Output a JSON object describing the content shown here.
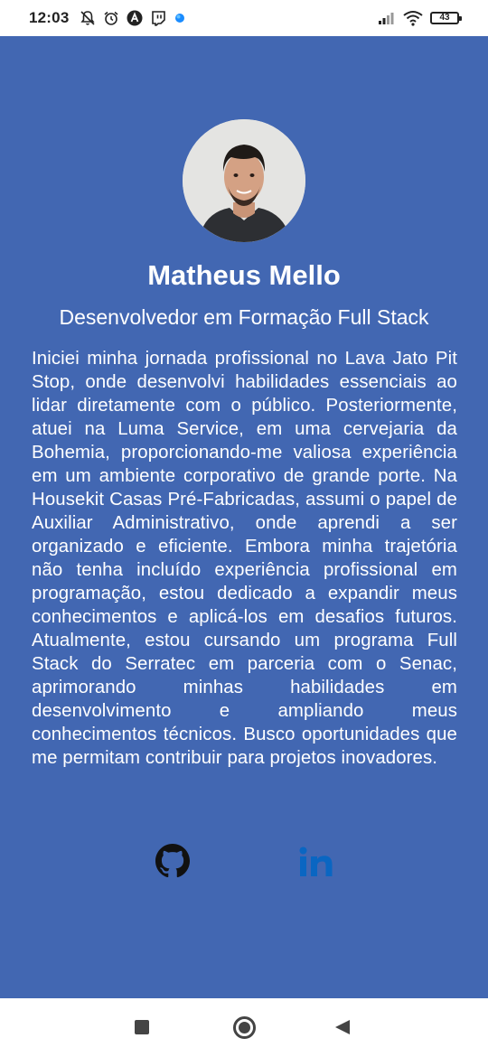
{
  "status_bar": {
    "time": "12:03",
    "icons_left": [
      "notifications-off-icon",
      "alarm-icon",
      "app-a-icon",
      "twitch-icon",
      "blue-dot-icon"
    ],
    "icons_right": [
      "signal-icon",
      "wifi-icon",
      "battery-icon"
    ],
    "battery_level": "43"
  },
  "profile": {
    "name": "Matheus Mello",
    "role": "Desenvolvedor em Formação Full Stack",
    "bio": "Iniciei minha jornada profissional no Lava Jato Pit Stop, onde desenvolvi habilidades essenciais ao lidar diretamente com o público. Posteriormente, atuei na Luma Service, em uma cervejaria da Bohemia, proporcionando-me valiosa experiência em um ambiente corporativo de grande porte. Na Housekit Casas Pré-Fabricadas, assumi o papel de Auxiliar Administrativo, onde aprendi a ser organizado e eficiente. Embora minha trajetória não tenha incluído experiência profissional em programação, estou dedicado a expandir meus conhecimentos e aplicá-los em desafios futuros. Atualmente, estou cursando um programa Full Stack do Serratec em parceria com o Senac, aprimorando minhas habilidades em desenvolvimento e ampliando meus conhecimentos técnicos. Busco oportunidades que me permitam contribuir para projetos inovadores."
  },
  "social": {
    "icons": [
      "github-icon",
      "linkedin-icon"
    ],
    "linkedin_color": "#0a66c2"
  },
  "colors": {
    "background": "#4267b2",
    "text": "#ffffff"
  },
  "nav_bar": {
    "icons": [
      "recents-icon",
      "home-icon",
      "back-icon"
    ]
  }
}
